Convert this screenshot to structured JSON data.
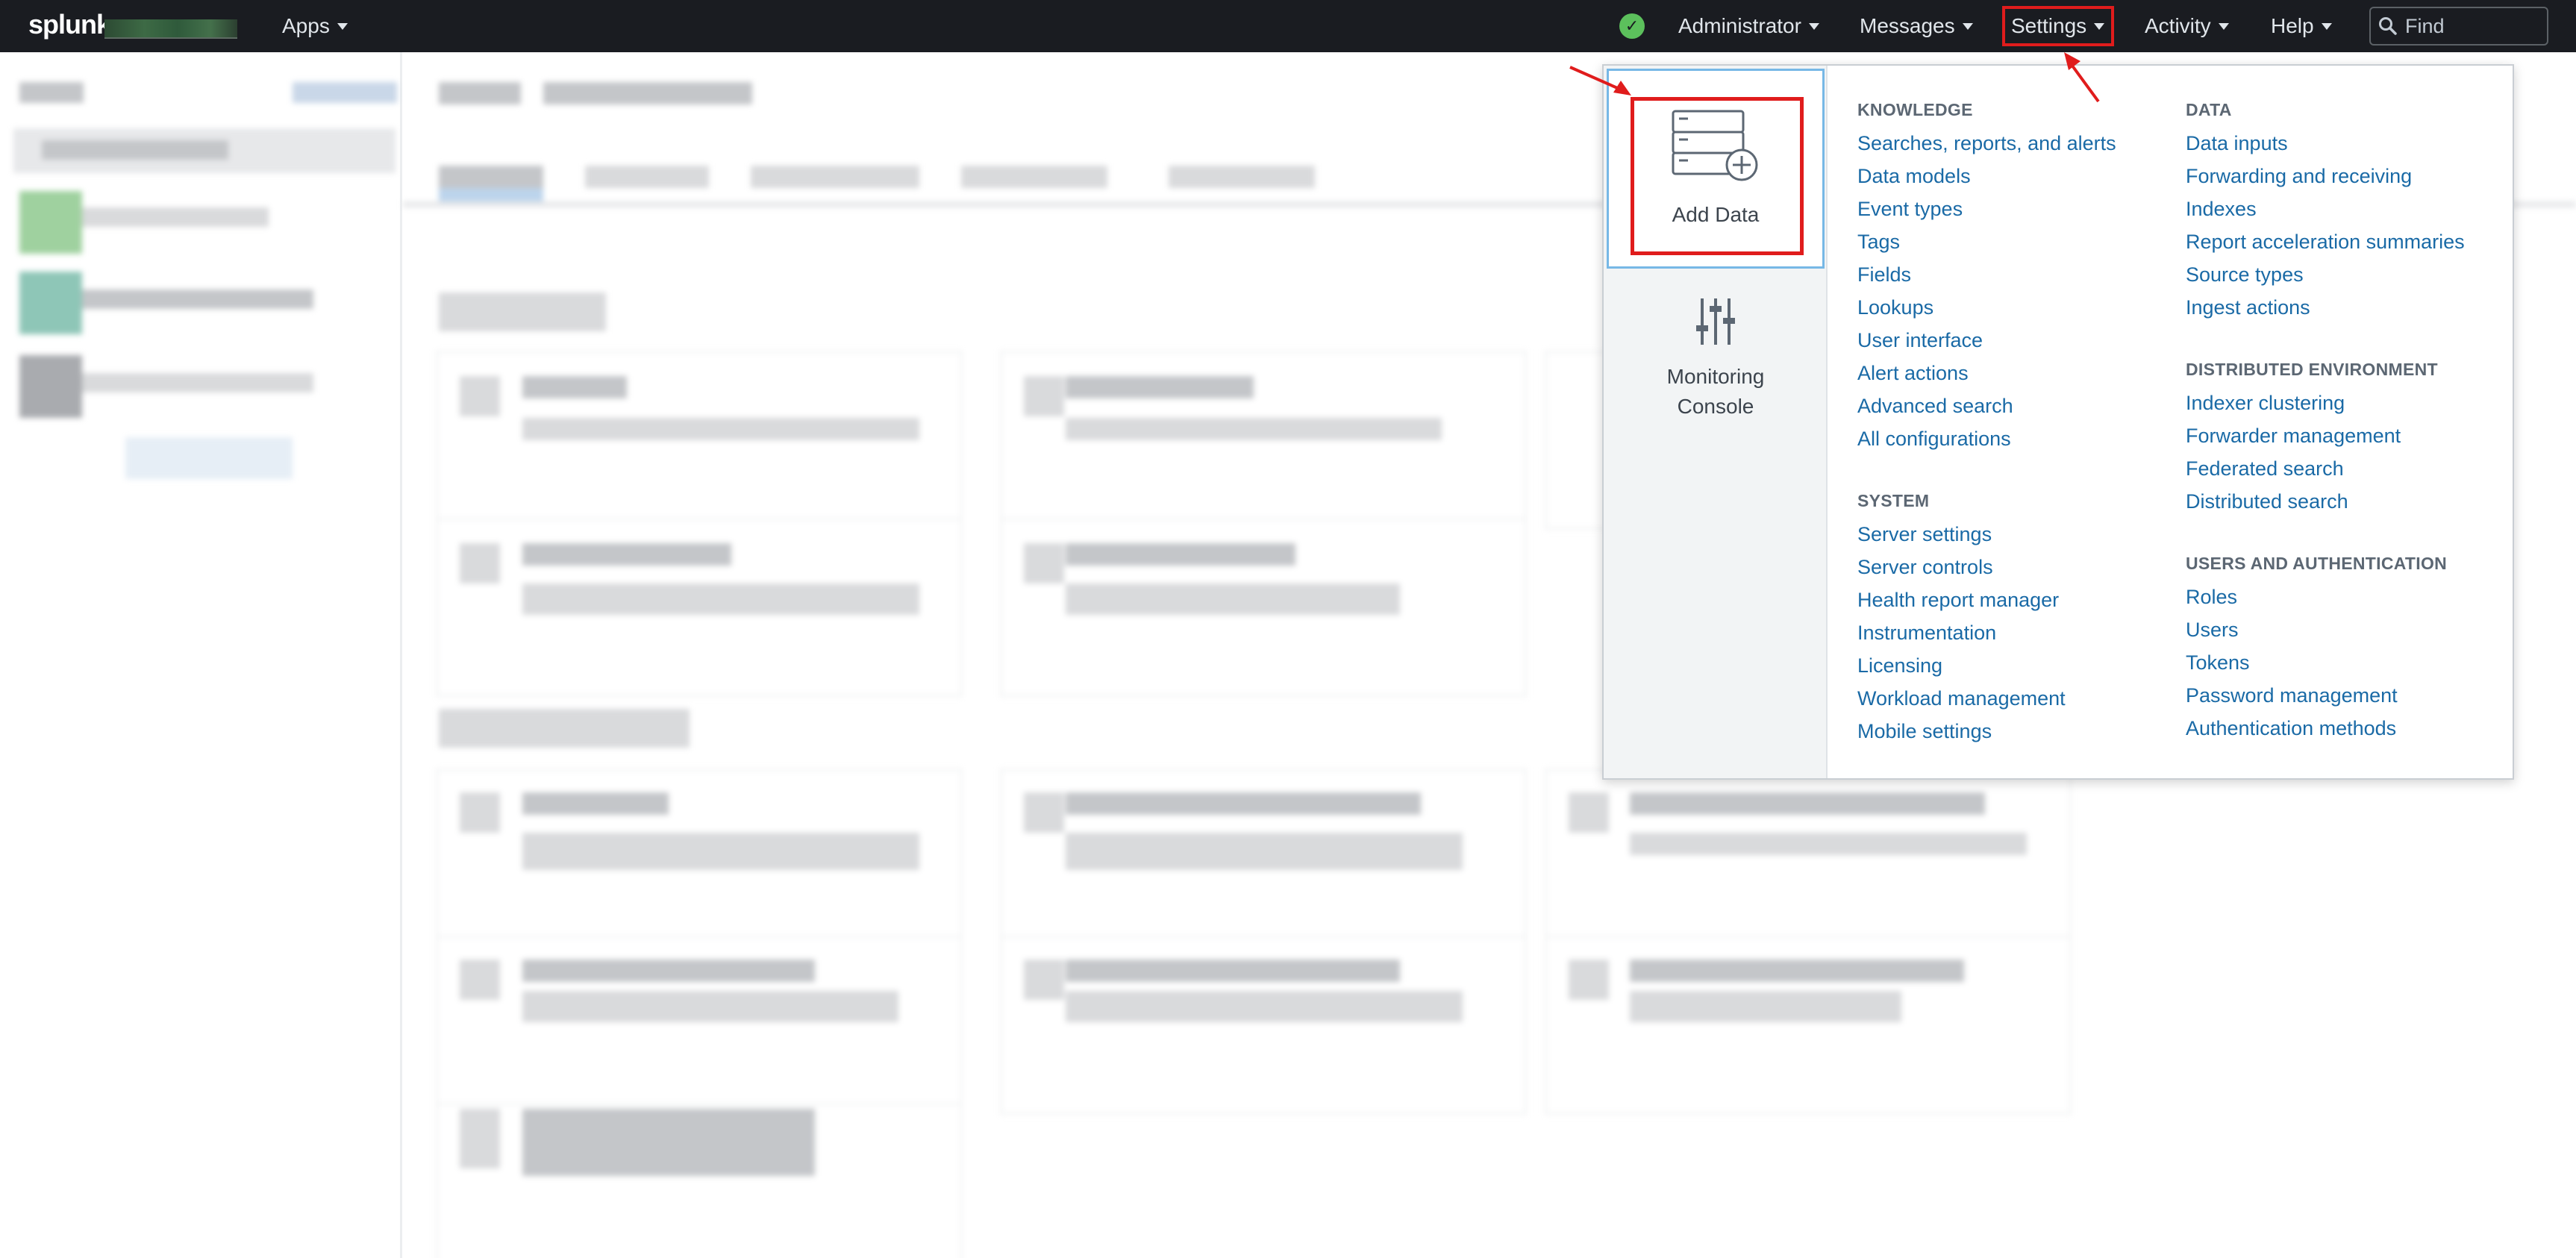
{
  "topbar": {
    "logo": "splunk",
    "apps_label": "Apps",
    "status_icon": "check-circle-icon",
    "status_symbol": "✓",
    "user_label": "Administrator",
    "messages_label": "Messages",
    "settings_label": "Settings",
    "activity_label": "Activity",
    "help_label": "Help",
    "find_placeholder": "Find"
  },
  "settings_menu": {
    "tiles": [
      {
        "label": "Add Data",
        "icon": "add-data-server-icon"
      },
      {
        "label": "Monitoring Console",
        "icon": "sliders-icon"
      }
    ],
    "knowledge": {
      "title": "KNOWLEDGE",
      "items": [
        "Searches, reports, and alerts",
        "Data models",
        "Event types",
        "Tags",
        "Fields",
        "Lookups",
        "User interface",
        "Alert actions",
        "Advanced search",
        "All configurations"
      ]
    },
    "system": {
      "title": "SYSTEM",
      "items": [
        "Server settings",
        "Server controls",
        "Health report manager",
        "Instrumentation",
        "Licensing",
        "Workload management",
        "Mobile settings"
      ]
    },
    "data": {
      "title": "DATA",
      "items": [
        "Data inputs",
        "Forwarding and receiving",
        "Indexes",
        "Report acceleration summaries",
        "Source types",
        "Ingest actions"
      ]
    },
    "distributed": {
      "title": "DISTRIBUTED ENVIRONMENT",
      "items": [
        "Indexer clustering",
        "Forwarder management",
        "Federated search",
        "Distributed search"
      ]
    },
    "users": {
      "title": "USERS AND AUTHENTICATION",
      "items": [
        "Roles",
        "Users",
        "Tokens",
        "Password management",
        "Authentication methods"
      ]
    }
  },
  "colors": {
    "topbar_bg": "#1a1c21",
    "link": "#1a6aa6",
    "highlight": "#e01c1c",
    "status_ok": "#5cc05c"
  }
}
